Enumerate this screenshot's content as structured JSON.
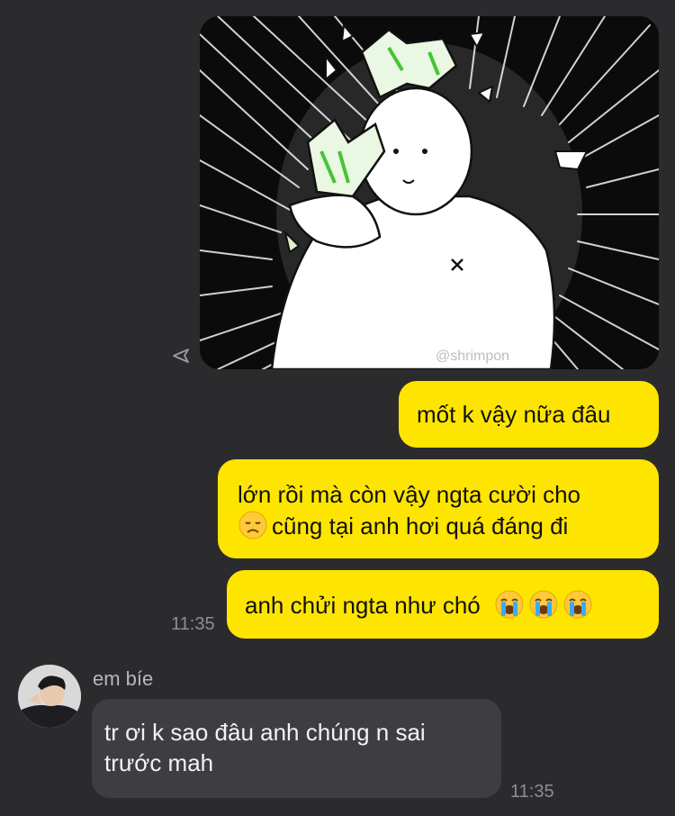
{
  "image_message": {
    "watermark": "@shrimpon"
  },
  "outgoing": [
    {
      "text": "mốt k vậy nữa đâu"
    },
    {
      "line1": "lớn rồi mà còn vậy ngta cười cho",
      "line2": "cũng tại anh hơi quá đáng đi",
      "emoji": "disappointed-face"
    },
    {
      "text": "anh chửi ngta như chó",
      "emojis": [
        "loudly-crying-face",
        "loudly-crying-face",
        "loudly-crying-face"
      ]
    }
  ],
  "outgoing_time": "11:35",
  "incoming": {
    "sender": "em bíe",
    "text": "tr ơi k sao đâu anh chúng n sai trước mah",
    "time": "11:35"
  },
  "colors": {
    "background": "#2b2b2d",
    "outgoing_bubble": "#fee500",
    "incoming_bubble": "#3e3e42",
    "timestamp": "#8e8e93"
  }
}
